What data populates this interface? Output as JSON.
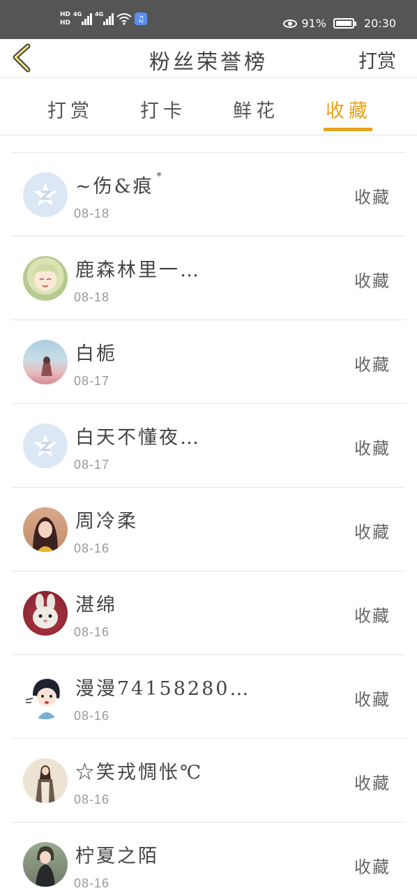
{
  "status_bar": {
    "hd1": "HD",
    "hd2": "HD",
    "net1": "4G",
    "net2": "4G",
    "battery_percent": "91%",
    "time": "20:30",
    "icons": [
      "hd-icon",
      "signal-icon",
      "wifi-icon",
      "music-icon",
      "eye-icon",
      "battery-icon"
    ]
  },
  "header": {
    "title": "粉丝荣誉榜",
    "right_action": "打赏",
    "back_icon": "chevron-left-icon"
  },
  "tabs": [
    {
      "label": "打赏",
      "active": false
    },
    {
      "label": "打卡",
      "active": false
    },
    {
      "label": "鲜花",
      "active": false
    },
    {
      "label": "收藏",
      "active": true
    }
  ],
  "accent_color": "#e8a21a",
  "fans": [
    {
      "name": "~伤&痕",
      "suffix": "*",
      "date": "08-18",
      "action": "收藏",
      "avatar": "qq-default-avatar"
    },
    {
      "name": "鹿森林里一…",
      "date": "08-18",
      "action": "收藏",
      "avatar": "anime-girl-avatar"
    },
    {
      "name": "白栀",
      "date": "08-17",
      "action": "收藏",
      "avatar": "girl-by-sea-avatar"
    },
    {
      "name": "白天不懂夜…",
      "date": "08-17",
      "action": "收藏",
      "avatar": "qq-default-avatar"
    },
    {
      "name": "周冷柔",
      "date": "08-16",
      "action": "收藏",
      "avatar": "girl-photo-avatar"
    },
    {
      "name": "湛绵",
      "date": "08-16",
      "action": "收藏",
      "avatar": "rabbit-avatar"
    },
    {
      "name": "漫漫74158280…",
      "date": "08-16",
      "action": "收藏",
      "avatar": "cartoon-boy-avatar"
    },
    {
      "name": "☆笑戎惆怅℃",
      "date": "08-16",
      "action": "收藏",
      "avatar": "girl-standing-avatar"
    },
    {
      "name": "柠夏之陌",
      "date": "08-16",
      "action": "收藏",
      "avatar": "girl-dark-dress-avatar"
    }
  ]
}
